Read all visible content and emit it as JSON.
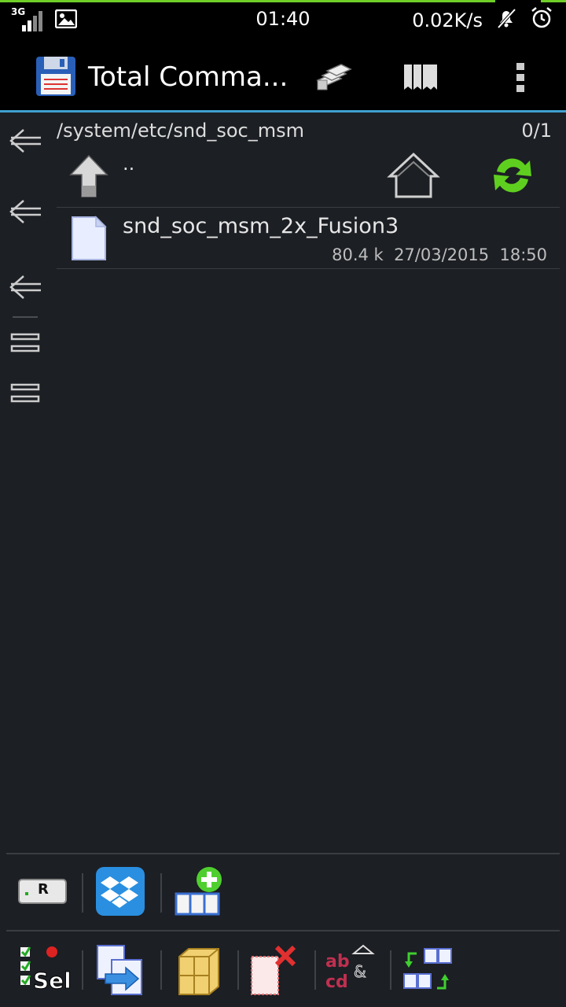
{
  "status_bar": {
    "network_label": "3G",
    "time": "01:40",
    "speed": "0.02K/s"
  },
  "app_bar": {
    "title": "Total Comma...",
    "icons": [
      "floppy-disk-icon",
      "copy-stack-icon",
      "bookmarks-icon",
      "overflow-menu-icon"
    ]
  },
  "panel": {
    "path": "/system/etc/snd_soc_msm",
    "selection_count": "0/1",
    "parent_label": "..",
    "files": [
      {
        "name": "snd_soc_msm_2x_Fusion3",
        "size": "80.4 k",
        "date": "27/03/2015",
        "time": "18:50"
      }
    ]
  },
  "toolbar_top": {
    "icons": [
      "r-plugin-icon",
      "dropbox-icon",
      "add-button-icon"
    ],
    "plugin_label": "R"
  },
  "toolbar_bottom": {
    "select_label": "Sel",
    "rename_label_top": "ab",
    "rename_label_bottom": "cd",
    "icons": [
      "select-icon",
      "copy-move-icon",
      "pack-icon",
      "delete-icon",
      "rename-icon",
      "swap-panels-icon"
    ]
  },
  "colors": {
    "accent": "#3fa0d0",
    "green": "#6fcf27",
    "background": "#1c1f24"
  }
}
